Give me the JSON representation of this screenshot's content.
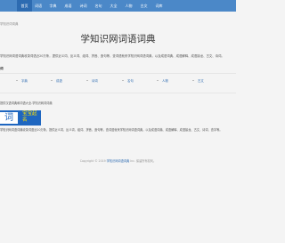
{
  "nav": {
    "items": [
      "首页",
      "词语",
      "字典",
      "成语",
      "诗词",
      "名句",
      "大全",
      "人物",
      "古文",
      "词库"
    ],
    "active_index": 0
  },
  "breadcrumb": "学知识词词典",
  "site_title": "学知识网词语词典",
  "intro": "学知识网词语词典收录词语近20万条，提供近义词、反义词、组词、拼音、造句等，查词语就来学知识网词语词典，以及成语词典、成语解释、成语接龙、古文、诗词。",
  "section_heading": "词",
  "categories": [
    {
      "label": "字典"
    },
    {
      "label": "成语"
    },
    {
      "label": "诗词"
    },
    {
      "label": "名句"
    },
    {
      "label": "人物"
    },
    {
      "label": "古文"
    }
  ],
  "sub_heading": "提供汉语词典和词语大全-学知识网词词典",
  "logo": {
    "left": "词",
    "right": "宝宝起名"
  },
  "description": "学知识网词语词典收录词语近20万条，提供近义词、反义词、组词、拼音、造句等，查词语就来学知识网词语词典，以及成语词典、成语解释、成语接龙、古文、诗词、查字等。",
  "footer": {
    "prefix": "Copyright © 2019",
    "link": "学知识网词语词典",
    "suffix": "Inc. 保留所有权利。"
  }
}
